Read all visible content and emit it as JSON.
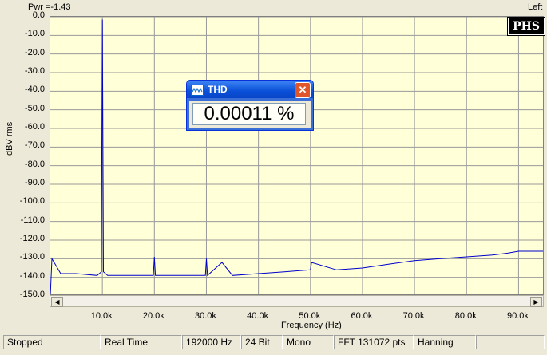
{
  "header": {
    "power": "Pwr =-1.43",
    "channel": "Left"
  },
  "badge": "PHS",
  "thd_window": {
    "title": "THD",
    "value": "0.00011 %"
  },
  "axis": {
    "ylabel": "dBV rms",
    "xlabel": "Frequency (Hz)",
    "yticks": [
      "0.0",
      "-10.0",
      "-20.0",
      "-30.0",
      "-40.0",
      "-50.0",
      "-60.0",
      "-70.0",
      "-80.0",
      "-90.0",
      "-100.0",
      "-110.0",
      "-120.0",
      "-130.0",
      "-140.0",
      "-150.0"
    ],
    "xticks": [
      "10.0k",
      "20.0k",
      "30.0k",
      "40.0k",
      "50.0k",
      "60.0k",
      "70.0k",
      "80.0k",
      "90.0k"
    ]
  },
  "statusbar": {
    "state": "Stopped",
    "mode": "Real Time",
    "rate": "192000 Hz",
    "bits": "24 Bit",
    "channels": "Mono",
    "fft": "FFT 131072 pts",
    "window": "Hanning"
  },
  "chart_data": {
    "type": "line",
    "xlabel": "Frequency (Hz)",
    "ylabel": "dBV rms",
    "xlim": [
      0,
      95000
    ],
    "ylim": [
      -150,
      0
    ],
    "grid": true,
    "series": [
      {
        "color": "#0000cc",
        "x": [
          0,
          300,
          2000,
          5000,
          9000,
          9800,
          10000,
          10200,
          11000,
          15000,
          19800,
          20000,
          20200,
          25000,
          29800,
          30000,
          30200,
          33000,
          35000,
          40000,
          45000,
          50000,
          50200,
          55000,
          60000,
          65000,
          70000,
          75000,
          80000,
          85000,
          88000,
          90000,
          92000,
          95000
        ],
        "y": [
          -150,
          -130,
          -138,
          -138,
          -139,
          -137,
          -1.5,
          -137,
          -139,
          -139,
          -139,
          -129,
          -139,
          -139,
          -139,
          -130,
          -139,
          -132,
          -139,
          -138,
          -137,
          -136,
          -132,
          -136,
          -135,
          -133,
          -131,
          -130,
          -129,
          -128,
          -127,
          -126,
          -126,
          -126
        ]
      }
    ]
  }
}
